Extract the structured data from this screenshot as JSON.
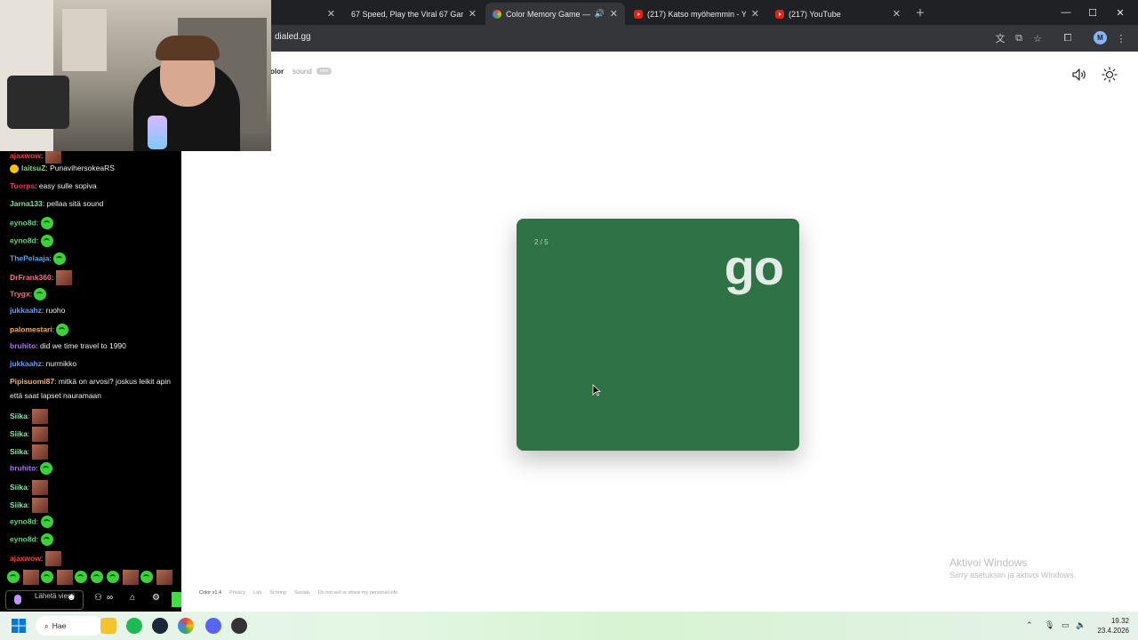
{
  "browser": {
    "tabs": [
      {
        "title": "",
        "active": false,
        "icon": "blank"
      },
      {
        "title": "67 Speed, Play the Viral 67 Gam",
        "active": false,
        "icon": "blank"
      },
      {
        "title": "Color Memory Game — Ho",
        "active": true,
        "icon": "color-wheel"
      },
      {
        "title": "(217) Katso myöhemmin - YouT",
        "active": false,
        "icon": "youtube"
      },
      {
        "title": "(217) YouTube",
        "active": false,
        "icon": "youtube"
      }
    ],
    "url": "dialed.gg",
    "profile_initial": "M"
  },
  "page": {
    "nav": {
      "color_label": "olor",
      "sound_label": "sound",
      "new_badge": "new"
    },
    "card": {
      "counter": "2 / 5",
      "word": "go",
      "color": "#2f7246"
    },
    "footer": {
      "version": "Color v1.4",
      "links": [
        "Privacy",
        "Lab",
        "Scoring",
        "Socials",
        "Do not sell or share my personal info"
      ]
    }
  },
  "windows_watermark": {
    "line1": "Aktivoi Windows",
    "line2": "Siirry asetuksiin ja aktivoi Windows."
  },
  "chat": {
    "messages": [
      {
        "user": "laitsuZ",
        "text": "PunavihersokeaRS",
        "color": "#7cd67c",
        "badge": "#f5c400"
      },
      {
        "user": "Tuorps",
        "text": "easy sulle sopiva",
        "color": "#ff2b5a"
      },
      {
        "user": "Jarna133",
        "text": "pellaa sitä sound",
        "color": "#7ee0a0"
      },
      {
        "user": "eyno8d",
        "text": "",
        "color": "#5ed67a",
        "emote": "green"
      },
      {
        "user": "eyno8d",
        "text": "",
        "color": "#5ed67a",
        "emote": "green"
      },
      {
        "user": "ThePelaaja",
        "text": "",
        "color": "#4aa3ff",
        "emote": "green"
      },
      {
        "user": "DrFrank360",
        "text": "",
        "color": "#ff6b8b",
        "emote": "pic"
      },
      {
        "user": "Trygx",
        "text": "",
        "color": "#ff6b6b",
        "emote": "green"
      },
      {
        "user": "jukkaahz",
        "text": "ruoho",
        "color": "#5b9bff"
      },
      {
        "user": "palomestari",
        "text": "",
        "color": "#ffae3b",
        "emote": "green"
      },
      {
        "user": "bruhito",
        "text": "did we time travel to 1990",
        "color": "#b06bff"
      },
      {
        "user": "jukkaahz",
        "text": "nurmikko",
        "color": "#5b9bff"
      },
      {
        "user": "Pipisuomi87",
        "text": "mitkä on arvosi? joskus leikit apin",
        "color": "#f0b070"
      },
      {
        "user": "",
        "text": "että saat lapset nauramaan",
        "color": "#efeff1"
      },
      {
        "user": "Siika",
        "text": "",
        "color": "#8de0a8",
        "emote": "pic"
      },
      {
        "user": "Siika",
        "text": "",
        "color": "#8de0a8",
        "emote": "pic"
      },
      {
        "user": "Siika",
        "text": "",
        "color": "#8de0a8",
        "emote": "pic"
      },
      {
        "user": "bruhito",
        "text": "",
        "color": "#b06bff",
        "emote": "green"
      },
      {
        "user": "Siika",
        "text": "",
        "color": "#8de0a8",
        "emote": "pic"
      },
      {
        "user": "Siika",
        "text": "",
        "color": "#8de0a8",
        "emote": "pic"
      },
      {
        "user": "eyno8d",
        "text": "",
        "color": "#5ed67a",
        "emote": "green"
      },
      {
        "user": "eyno8d",
        "text": "",
        "color": "#5ed67a",
        "emote": "green"
      },
      {
        "user": "ajaxwow",
        "text": "",
        "color": "#ff3b3b",
        "emote": "pic"
      }
    ],
    "input_placeholder": "Lähetä viesti"
  },
  "taskbar": {
    "search_label": "Hae",
    "time": "19.32",
    "date": "23.4.2026"
  }
}
